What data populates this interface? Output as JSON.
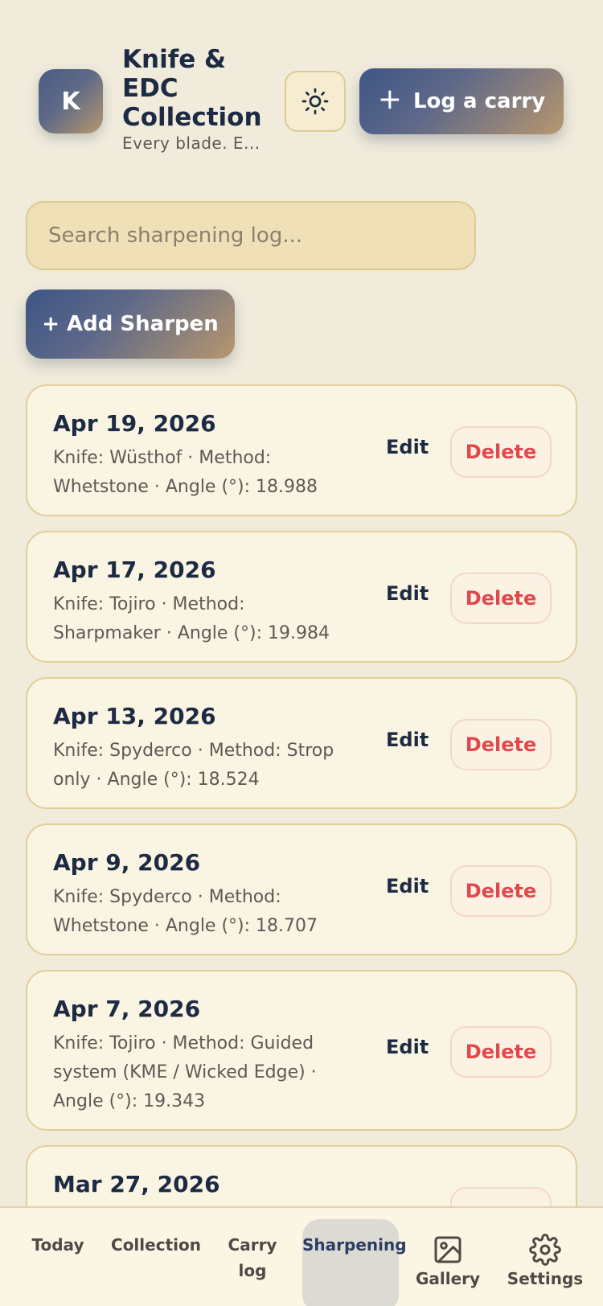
{
  "header": {
    "avatar_letter": "K",
    "title": "Knife & EDC Collection",
    "subtitle": "Every blade. E...",
    "theme_icon": "sun-icon",
    "carry_button_label": "Log a carry"
  },
  "search": {
    "placeholder": "Search sharpening log..."
  },
  "add_button_label": "+ Add Sharpen",
  "entries": [
    {
      "date": "Apr 19, 2026",
      "details": "Knife: Wüsthof · Method: Whetstone · Angle (°): 18.988",
      "edit": "Edit",
      "delete": "Delete"
    },
    {
      "date": "Apr 17, 2026",
      "details": "Knife: Tojiro · Method: Sharpmaker · Angle (°): 19.984",
      "edit": "Edit",
      "delete": "Delete"
    },
    {
      "date": "Apr 13, 2026",
      "details": "Knife: Spyderco · Method: Strop only · Angle (°): 18.524",
      "edit": "Edit",
      "delete": "Delete"
    },
    {
      "date": "Apr 9, 2026",
      "details": "Knife: Spyderco · Method: Whetstone · Angle (°): 18.707",
      "edit": "Edit",
      "delete": "Delete"
    },
    {
      "date": "Apr 7, 2026",
      "details": "Knife: Tojiro · Method: Guided system (KME / Wicked Edge) · Angle (°): 19.343",
      "edit": "Edit",
      "delete": "Delete"
    },
    {
      "date": "Mar 27, 2026",
      "details": "",
      "edit": "",
      "delete": ""
    }
  ],
  "nav": {
    "today": "Today",
    "collection": "Collection",
    "carry_log": "Carry log",
    "sharpening": "Sharpening",
    "gallery": "Gallery",
    "settings": "Settings"
  }
}
